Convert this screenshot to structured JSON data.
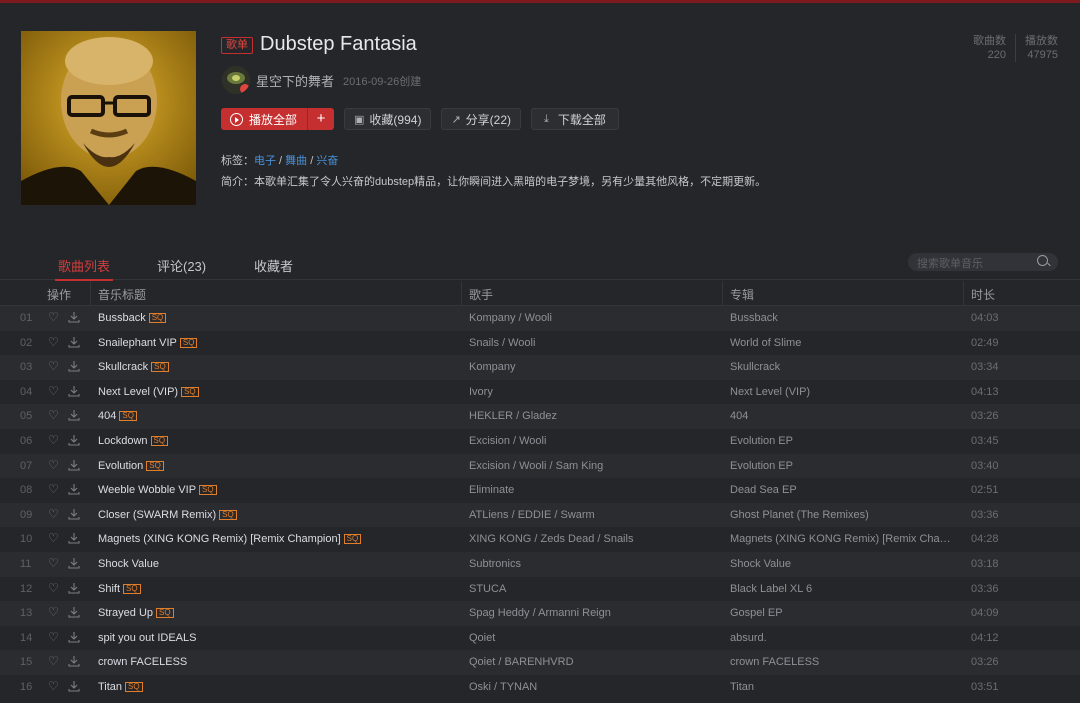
{
  "colors": {
    "accent": "#c62f2f",
    "background": "#252629",
    "sq_badge": "#e27d2a",
    "link": "#4a8fd6"
  },
  "playlist": {
    "type_badge": "歌单",
    "title": "Dubstep Fantasia",
    "creator": "星空下的舞者",
    "created": "2016-09-26创建",
    "stats": [
      {
        "label": "歌曲数",
        "value": "220"
      },
      {
        "label": "播放数",
        "value": "47975"
      }
    ],
    "buttons": {
      "play_all": "播放全部",
      "add": "+",
      "collect": "收藏(994)",
      "share": "分享(22)",
      "download": "下载全部"
    },
    "icons": {
      "play_all": "play-circle-icon",
      "collect": "folder-plus-icon",
      "share": "share-icon",
      "download": "download-icon"
    },
    "tags_label": "标签：",
    "tags": [
      "电子",
      "舞曲",
      "兴奋"
    ],
    "desc_label": "简介：",
    "description": "本歌单汇集了令人兴奋的dubstep精品，让你瞬间进入黑暗的电子梦境，另有少量其他风格，不定期更新。"
  },
  "tabs": [
    {
      "label": "歌曲列表",
      "active": true
    },
    {
      "label": "评论(23)",
      "active": false
    },
    {
      "label": "收藏者",
      "active": false
    }
  ],
  "search": {
    "placeholder": "搜索歌单音乐"
  },
  "table": {
    "headers": [
      "操作",
      "音乐标题",
      "歌手",
      "专辑",
      "时长"
    ],
    "sq_label": "SQ",
    "rows": [
      {
        "num": "01",
        "title": "Bussback",
        "sq": true,
        "artist": "Kompany / Wooli",
        "album": "Bussback",
        "duration": "04:03"
      },
      {
        "num": "02",
        "title": "Snailephant VIP",
        "sq": true,
        "artist": "Snails / Wooli",
        "album": "World of Slime",
        "duration": "02:49"
      },
      {
        "num": "03",
        "title": "Skullcrack",
        "sq": true,
        "artist": "Kompany",
        "album": "Skullcrack",
        "duration": "03:34"
      },
      {
        "num": "04",
        "title": "Next Level (VIP)",
        "sq": true,
        "artist": "Ivory",
        "album": "Next Level (VIP)",
        "duration": "04:13"
      },
      {
        "num": "05",
        "title": "404",
        "sq": true,
        "artist": "HEKLER / Gladez",
        "album": "404",
        "duration": "03:26"
      },
      {
        "num": "06",
        "title": "Lockdown",
        "sq": true,
        "artist": "Excision / Wooli",
        "album": "Evolution EP",
        "duration": "03:45"
      },
      {
        "num": "07",
        "title": "Evolution",
        "sq": true,
        "artist": "Excision / Wooli / Sam King",
        "album": "Evolution EP",
        "duration": "03:40"
      },
      {
        "num": "08",
        "title": "Weeble Wobble VIP",
        "sq": true,
        "artist": "Eliminate",
        "album": "Dead Sea EP",
        "duration": "02:51"
      },
      {
        "num": "09",
        "title": "Closer (SWARM Remix)",
        "sq": true,
        "artist": "ATLiens / EDDIE / Swarm",
        "album": "Ghost Planet (The Remixes)",
        "duration": "03:36"
      },
      {
        "num": "10",
        "title": "Magnets (XING KONG Remix) [Remix Champion]",
        "sq": true,
        "artist": "XING KONG / Zeds Dead / Snails",
        "album": "Magnets (XING KONG Remix) [Remix Cham…",
        "duration": "04:28"
      },
      {
        "num": "11",
        "title": "Shock Value",
        "sq": false,
        "artist": "Subtronics",
        "album": "Shock Value",
        "duration": "03:18"
      },
      {
        "num": "12",
        "title": "Shift",
        "sq": true,
        "artist": "STUCA",
        "album": "Black Label XL 6",
        "duration": "03:36"
      },
      {
        "num": "13",
        "title": "Strayed Up",
        "sq": true,
        "artist": "Spag Heddy / Armanni Reign",
        "album": "Gospel EP",
        "duration": "04:09"
      },
      {
        "num": "14",
        "title": "spit you out IDEALS",
        "sq": false,
        "artist": "Qoiet",
        "album": "absurd.",
        "duration": "04:12"
      },
      {
        "num": "15",
        "title": "crown FACELESS",
        "sq": false,
        "artist": "Qoiet / BARENHVRD",
        "album": "crown FACELESS",
        "duration": "03:26"
      },
      {
        "num": "16",
        "title": "Titan",
        "sq": true,
        "artist": "Oski / TYNAN",
        "album": "Titan",
        "duration": "03:51"
      }
    ]
  }
}
